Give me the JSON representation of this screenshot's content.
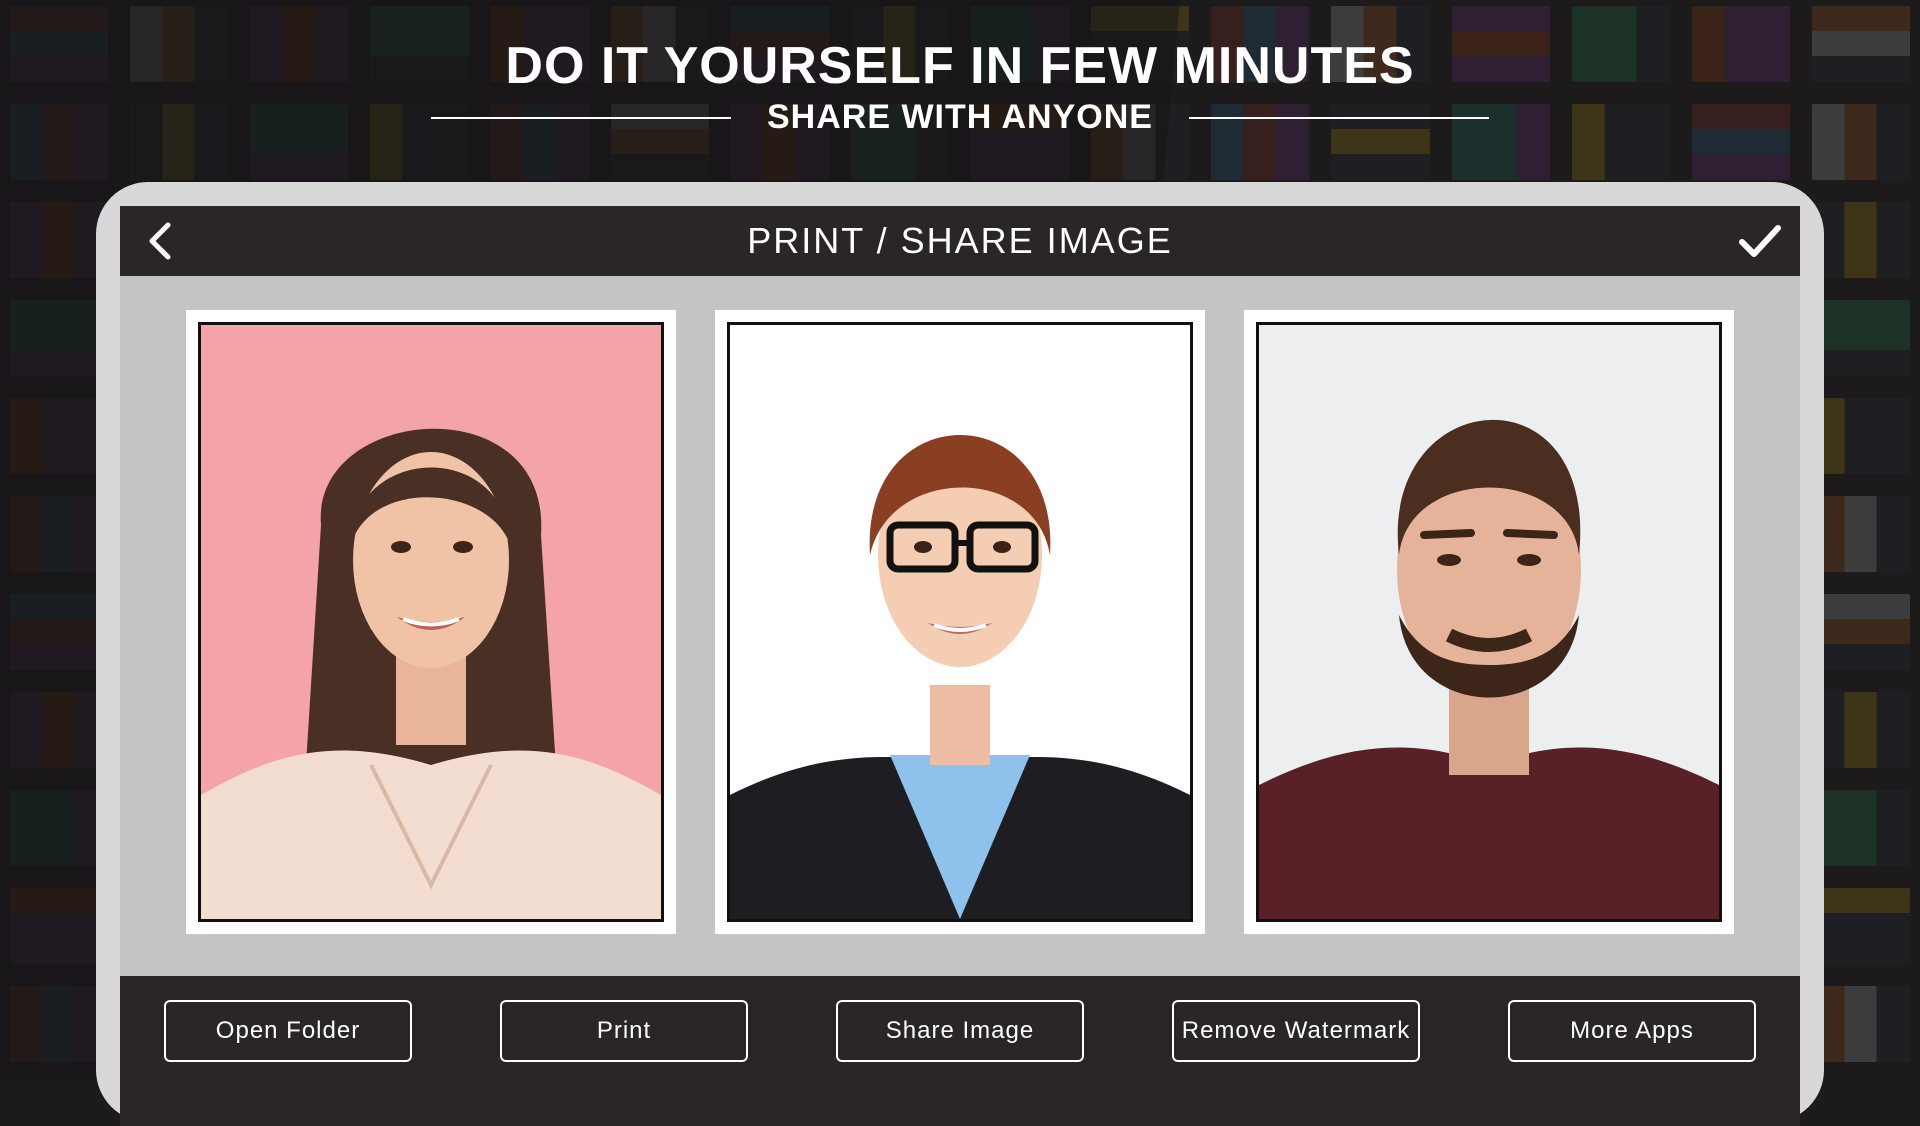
{
  "hero": {
    "title": "DO IT YOURSELF IN FEW MINUTES",
    "subtitle": "SHARE WITH ANYONE"
  },
  "toolbar": {
    "title": "PRINT / SHARE IMAGE",
    "back_icon": "chevron-left-icon",
    "confirm_icon": "checkmark-icon"
  },
  "photos": [
    {
      "name": "woman-pink-background-photo",
      "background": "#f4a3a6"
    },
    {
      "name": "woman-glasses-white-background-photo",
      "background": "#ffffff"
    },
    {
      "name": "bearded-man-grey-background-photo",
      "background": "#eceef0"
    }
  ],
  "actions": {
    "open_folder": "Open Folder",
    "print": "Print",
    "share_image": "Share Image",
    "remove_watermark": "Remove Watermark",
    "more_apps": "More Apps"
  },
  "colors": {
    "bar": "#2a2627",
    "frame": "#d8d8d8",
    "screen": "#c4c4c4",
    "text": "#ffffff"
  }
}
